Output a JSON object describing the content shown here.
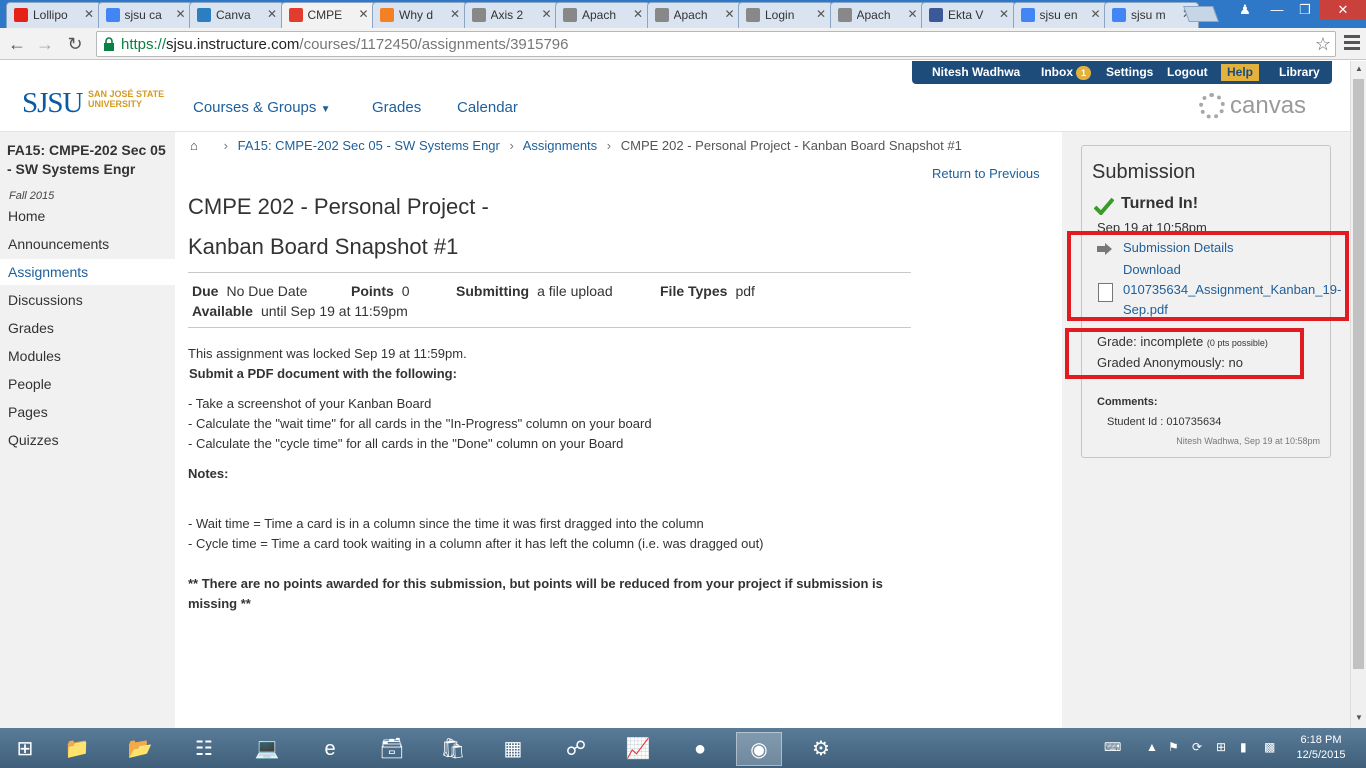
{
  "browser": {
    "tabs": [
      {
        "label": "Lollipo",
        "icon": "youtube-icon",
        "color": "#e62117"
      },
      {
        "label": "sjsu ca",
        "icon": "google-icon",
        "color": "#4285f4"
      },
      {
        "label": "Canva",
        "icon": "canvas-icon",
        "color": "#2b7fc0"
      },
      {
        "label": "CMPE",
        "icon": "canvas-icon",
        "color": "#e13c2d"
      },
      {
        "label": "Why d",
        "icon": "stackoverflow-icon",
        "color": "#f48024"
      },
      {
        "label": "Axis 2",
        "icon": "page-icon",
        "color": "#888888"
      },
      {
        "label": "Apach",
        "icon": "page-icon",
        "color": "#888888"
      },
      {
        "label": "Apach",
        "icon": "page-icon",
        "color": "#888888"
      },
      {
        "label": "Login",
        "icon": "page-icon",
        "color": "#888888"
      },
      {
        "label": "Apach",
        "icon": "page-icon",
        "color": "#888888"
      },
      {
        "label": "Ekta V",
        "icon": "facebook-icon",
        "color": "#3b5998"
      },
      {
        "label": "sjsu en",
        "icon": "google-icon",
        "color": "#4285f4"
      },
      {
        "label": "sjsu m",
        "icon": "google-icon",
        "color": "#4285f4"
      }
    ],
    "url_scheme": "https://",
    "url_host": "sjsu.instructure.com",
    "url_path": "/courses/1172450/assignments/3915796"
  },
  "header": {
    "user_name": "Nitesh Wadhwa",
    "inbox_label": "Inbox",
    "inbox_count": "1",
    "settings_label": "Settings",
    "logout_label": "Logout",
    "help_label": "Help",
    "library_label": "Library",
    "logo_text": "SJSU",
    "logo_sub": "SAN JOSÉ STATE UNIVERSITY",
    "nav": {
      "courses": "Courses & Groups",
      "grades": "Grades",
      "calendar": "Calendar"
    },
    "canvas_word": "canvas"
  },
  "course": {
    "title": "FA15: CMPE-202 Sec 05 - SW Systems Engr",
    "term": "Fall 2015",
    "nav": [
      "Home",
      "Announcements",
      "Assignments",
      "Discussions",
      "Grades",
      "Modules",
      "People",
      "Pages",
      "Quizzes"
    ],
    "active_nav": "Assignments"
  },
  "breadcrumb": {
    "course": "FA15: CMPE-202 Sec 05 - SW Systems Engr",
    "section": "Assignments",
    "current": "CMPE 202 - Personal Project - Kanban Board Snapshot #1"
  },
  "assignment": {
    "return_label": "Return to Previous",
    "title_line1": "CMPE 202 - Personal Project -",
    "title_line2": "Kanban Board Snapshot #1",
    "due_label": "Due",
    "due_value": "No Due Date",
    "points_label": "Points",
    "points_value": "0",
    "submitting_label": "Submitting",
    "submitting_value": "a file upload",
    "filetypes_label": "File Types",
    "filetypes_value": "pdf",
    "available_label": "Available",
    "available_value": "until Sep 19 at 11:59pm",
    "locked_text": "This assignment was locked Sep 19 at 11:59pm.",
    "submit_heading": "Submit a PDF document with the following:",
    "items": [
      "- Take a screenshot of your Kanban Board",
      "- Calculate the \"wait time\" for all cards in the \"In-Progress\" column on your board",
      "- Calculate the \"cycle time\" for all cards in the \"Done\" column on your Board"
    ],
    "notes_heading": "Notes:",
    "notes": [
      "- Wait time = Time a card is in a column since the time it was first dragged into the column",
      "- Cycle time = Time a card took waiting in a column after it has left the column (i.e. was dragged out)"
    ],
    "footer_line1": "** There are no points awarded for this submission, but points will be reduced from your project if submission is",
    "footer_line2": "missing **"
  },
  "submission": {
    "heading": "Submission",
    "status": "Turned In!",
    "date": "Sep 19 at 10:58pm",
    "details_link": "Submission Details",
    "download_label": "Download",
    "file_line1": "010735634_Assignment_Kanban_19-",
    "file_line2": "Sep.pdf",
    "grade_label": "Grade: incomplete",
    "grade_possible": "(0 pts possible)",
    "anon_label": "Graded Anonymously: no",
    "comments_label": "Comments:",
    "comment_text": "Student Id : 010735634",
    "comment_meta": "Nitesh Wadhwa, Sep 19 at 10:58pm",
    "highlight_color": "#e11b22"
  },
  "taskbar": {
    "time": "6:18 PM",
    "date": "12/5/2015"
  }
}
